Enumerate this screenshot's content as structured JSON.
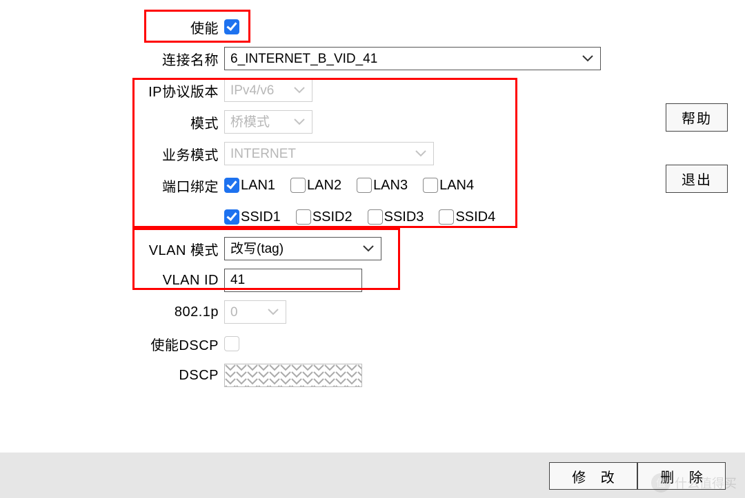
{
  "labels": {
    "enable": "使能",
    "conn_name": "连接名称",
    "ip_proto": "IP协议版本",
    "mode": "模式",
    "biz_mode": "业务模式",
    "port_bind": "端口绑定",
    "vlan_mode": "VLAN 模式",
    "vlan_id": "VLAN ID",
    "p8021": "802.1p",
    "enable_dscp": "使能DSCP",
    "dscp": "DSCP"
  },
  "values": {
    "enable": true,
    "conn_name": "6_INTERNET_B_VID_41",
    "ip_proto": "IPv4/v6",
    "mode": "桥模式",
    "biz_mode": "INTERNET",
    "vlan_mode": "改写(tag)",
    "vlan_id": "41",
    "p8021": "0",
    "enable_dscp": false,
    "dscp": ""
  },
  "ports": {
    "lan": [
      {
        "label": "LAN1",
        "checked": true
      },
      {
        "label": "LAN2",
        "checked": false
      },
      {
        "label": "LAN3",
        "checked": false
      },
      {
        "label": "LAN4",
        "checked": false
      }
    ],
    "ssid": [
      {
        "label": "SSID1",
        "checked": true
      },
      {
        "label": "SSID2",
        "checked": false
      },
      {
        "label": "SSID3",
        "checked": false
      },
      {
        "label": "SSID4",
        "checked": false
      }
    ]
  },
  "buttons": {
    "help": "帮助",
    "exit": "退出",
    "modify": "修 改",
    "delete": "删 除"
  },
  "watermark": "什么值得买"
}
